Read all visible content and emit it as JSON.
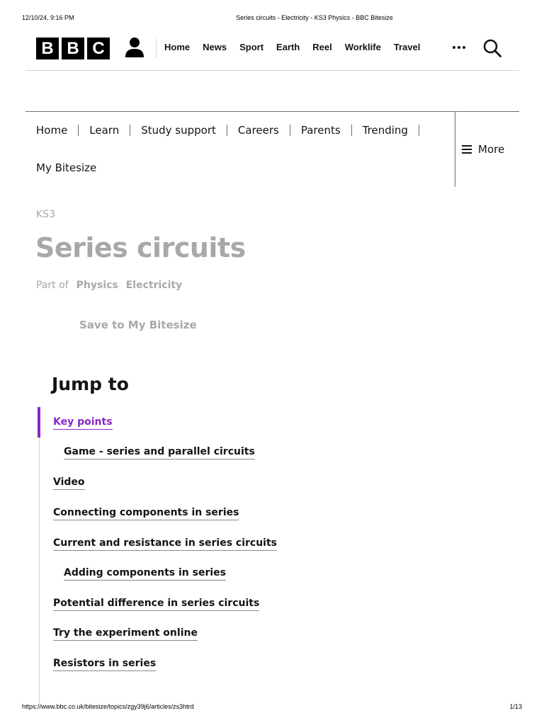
{
  "print_header": {
    "datetime": "12/10/24, 9:16 PM",
    "title": "Series circuits - Electricity - KS3 Physics - BBC Bitesize"
  },
  "bbc_header": {
    "logo_letters": [
      "B",
      "B",
      "C"
    ],
    "nav_items": [
      "Home",
      "News",
      "Sport",
      "Earth",
      "Reel",
      "Worklife",
      "Travel"
    ]
  },
  "bitesize_nav": {
    "items": [
      "Home",
      "Learn",
      "Study support",
      "Careers",
      "Parents",
      "Trending",
      "My Bitesize"
    ],
    "more_label": "More"
  },
  "page": {
    "level": "KS3",
    "title": "Series circuits",
    "part_of_label": "Part of",
    "part_of_links": [
      "Physics",
      "Electricity"
    ],
    "save_label": "Save to My Bitesize"
  },
  "jump_to": {
    "title": "Jump to",
    "links": [
      {
        "label": "Key points",
        "active": true,
        "indent": false
      },
      {
        "label": "Game - series and parallel circuits",
        "active": false,
        "indent": true
      },
      {
        "label": "Video",
        "active": false,
        "indent": false
      },
      {
        "label": "Connecting components in series",
        "active": false,
        "indent": false
      },
      {
        "label": "Current and resistance in series circuits",
        "active": false,
        "indent": false
      },
      {
        "label": "Adding components in series",
        "active": false,
        "indent": true
      },
      {
        "label": "Potential difference in series circuits",
        "active": false,
        "indent": false
      },
      {
        "label": "Try the experiment online",
        "active": false,
        "indent": false
      },
      {
        "label": "Resistors in series",
        "active": false,
        "indent": false
      }
    ]
  },
  "print_footer": {
    "url": "https://www.bbc.co.uk/bitesize/topics/zgy39j6/articles/zs3htrd",
    "page": "1/13"
  },
  "colors": {
    "accent_purple": "#8a25c9",
    "muted_grey": "#a8a8a8",
    "text": "#141414"
  }
}
